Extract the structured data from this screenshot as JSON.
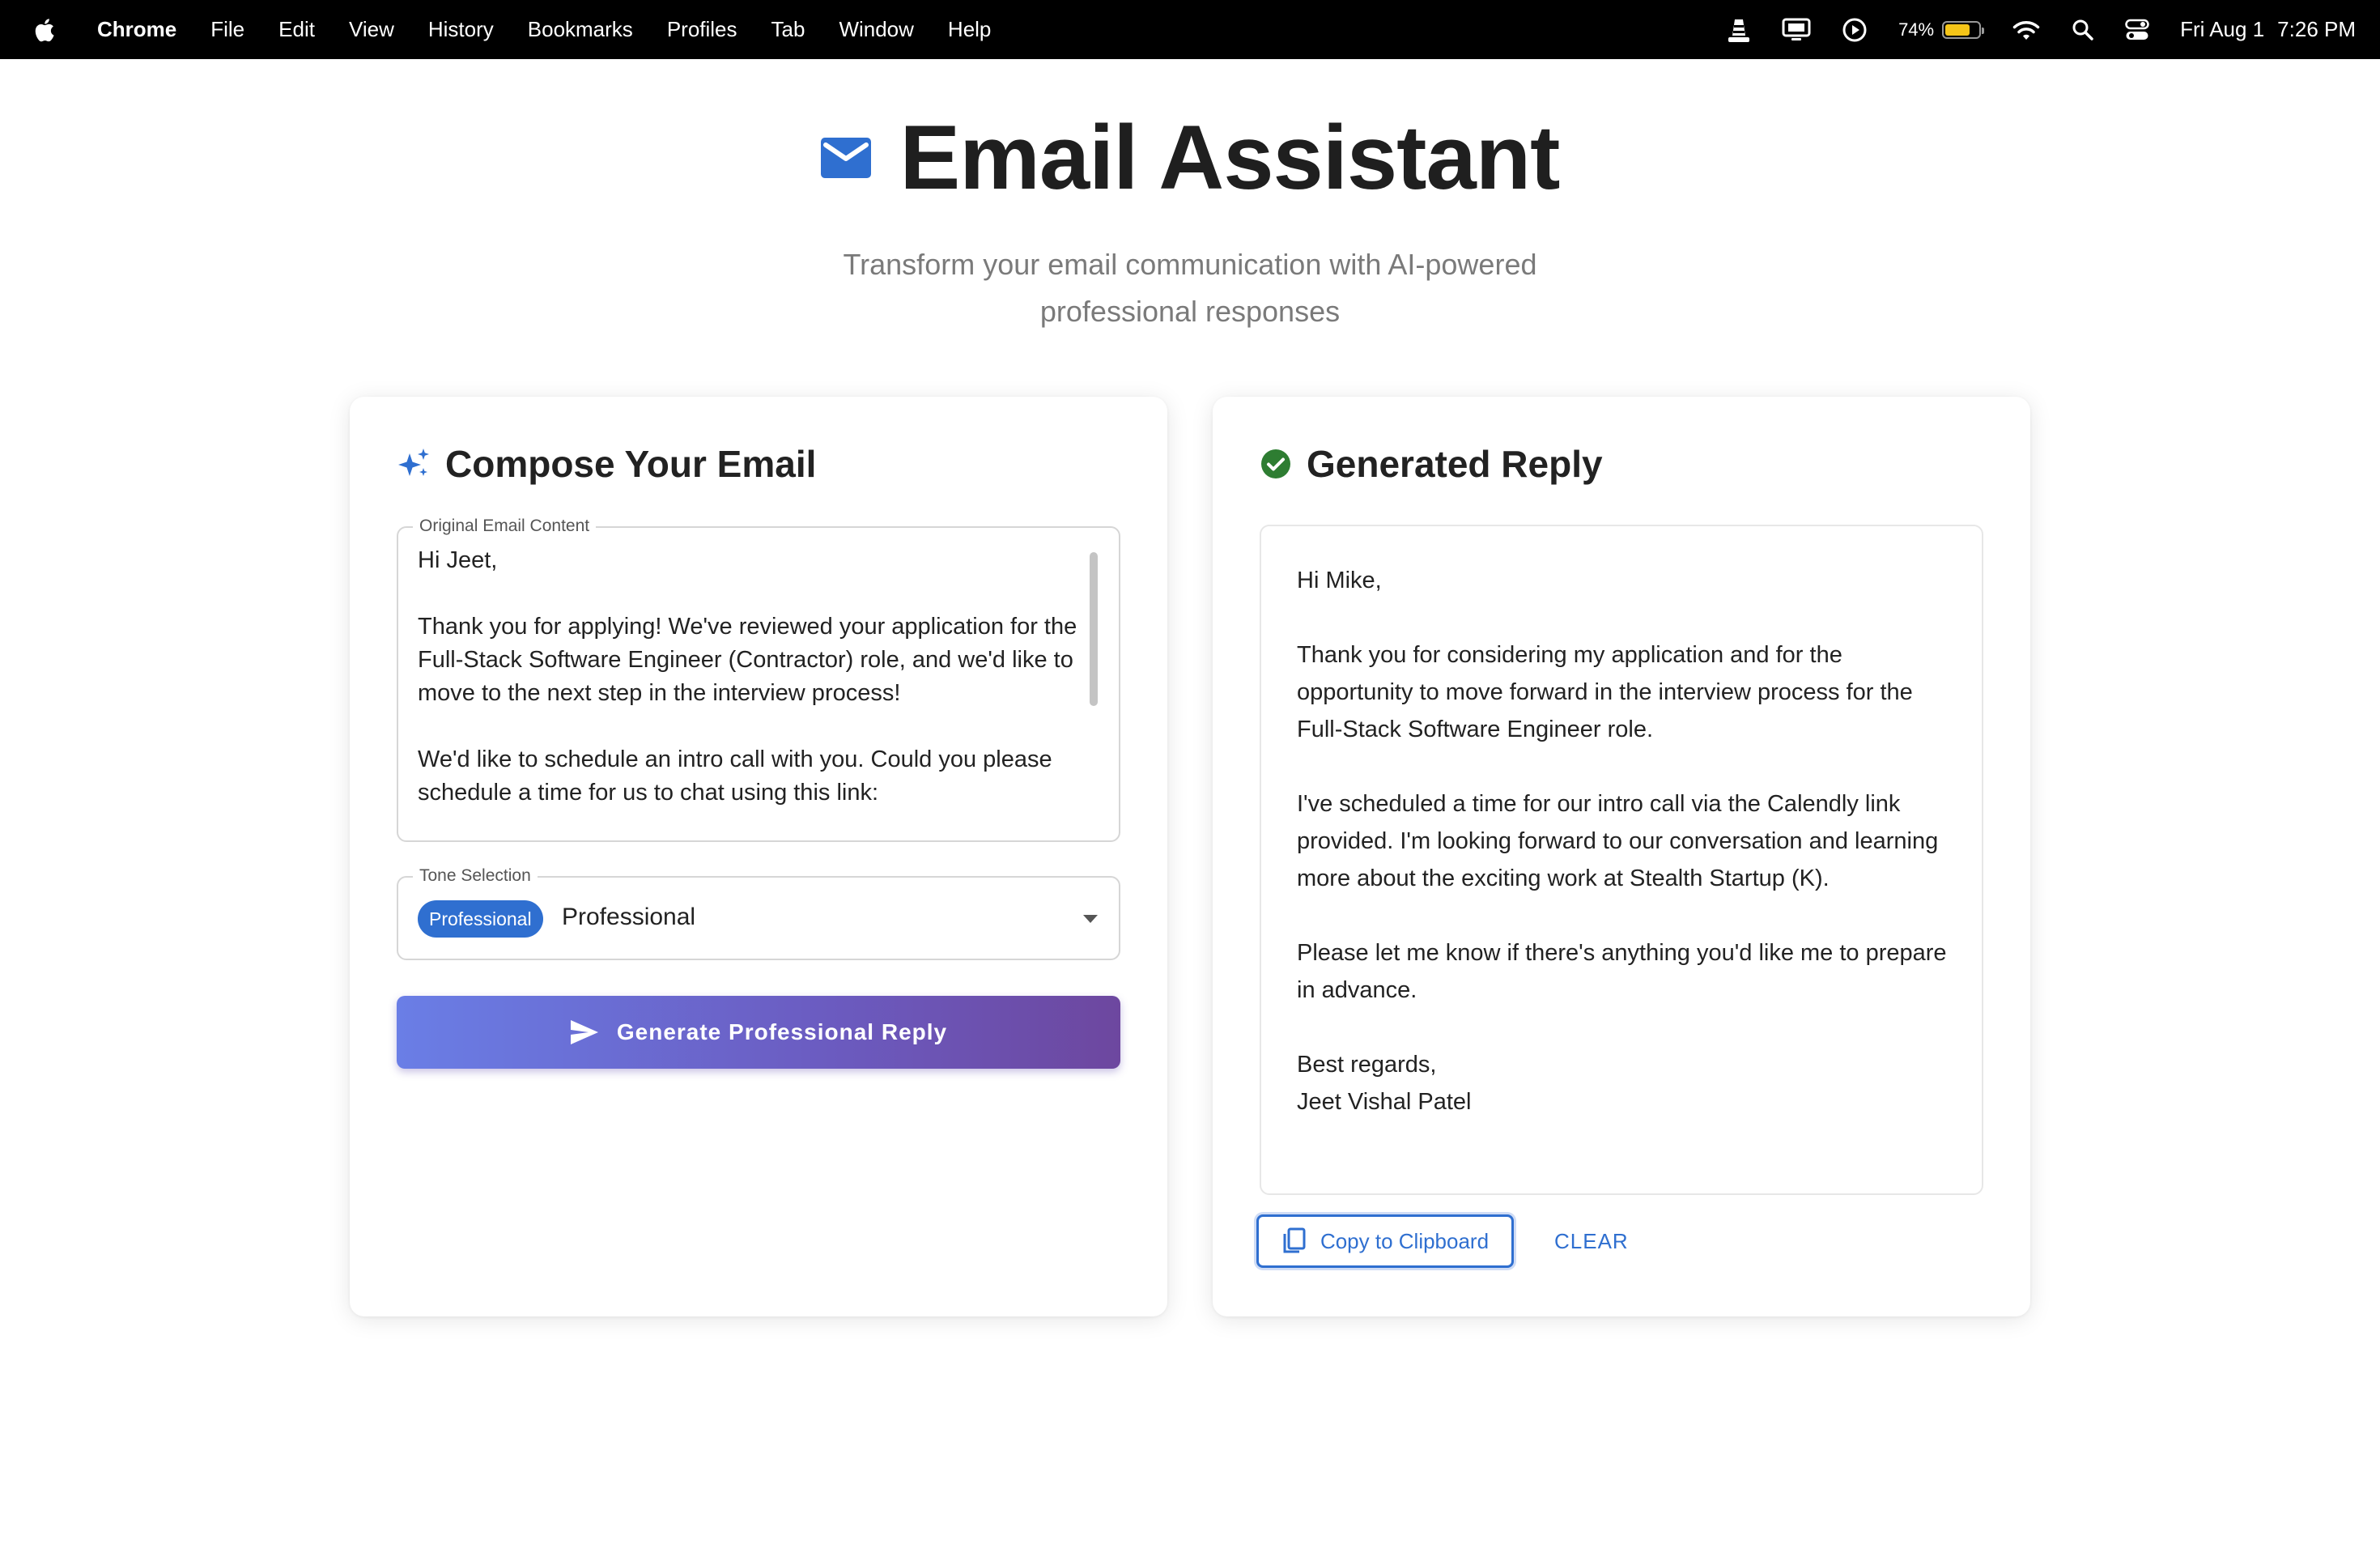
{
  "menubar": {
    "app_name": "Chrome",
    "menus": [
      "File",
      "Edit",
      "View",
      "History",
      "Bookmarks",
      "Profiles",
      "Tab",
      "Window",
      "Help"
    ],
    "battery_percent": "74%",
    "battery_level": 0.74,
    "date": "Fri Aug 1",
    "time": "7:26 PM"
  },
  "header": {
    "title": "Email Assistant",
    "subtitle": "Transform your email communication with AI-powered professional responses"
  },
  "compose": {
    "heading": "Compose Your Email",
    "email_label": "Original Email Content",
    "email_value": "Hi Jeet,\n\nThank you for applying! We've reviewed your application for the Full-Stack Software Engineer (Contractor) role, and we'd like to move to the next step in the interview process!\n\nWe'd like to schedule an intro call with you. Could you please schedule a time for us to chat using this link:",
    "tone_label": "Tone Selection",
    "tone_chip": "Professional",
    "tone_value": "Professional",
    "generate_button": "Generate Professional Reply"
  },
  "reply": {
    "heading": "Generated Reply",
    "content": "Hi Mike,\n\nThank you for considering my application and for the opportunity to move forward in the interview process for the Full-Stack Software Engineer role.\n\nI've scheduled a time for our intro call via the Calendly link provided. I'm looking forward to our conversation and learning more about the exciting work at Stealth Startup (K).\n\nPlease let me know if there's anything you'd like me to prepare in advance.\n\nBest regards,\nJeet Vishal Patel",
    "copy_button": "Copy to Clipboard",
    "clear_button": "CLEAR"
  },
  "colors": {
    "accent": "#2f6fd0",
    "success": "#2e7d32",
    "gradient_start": "#6a7ee6",
    "gradient_end": "#6d479f"
  }
}
